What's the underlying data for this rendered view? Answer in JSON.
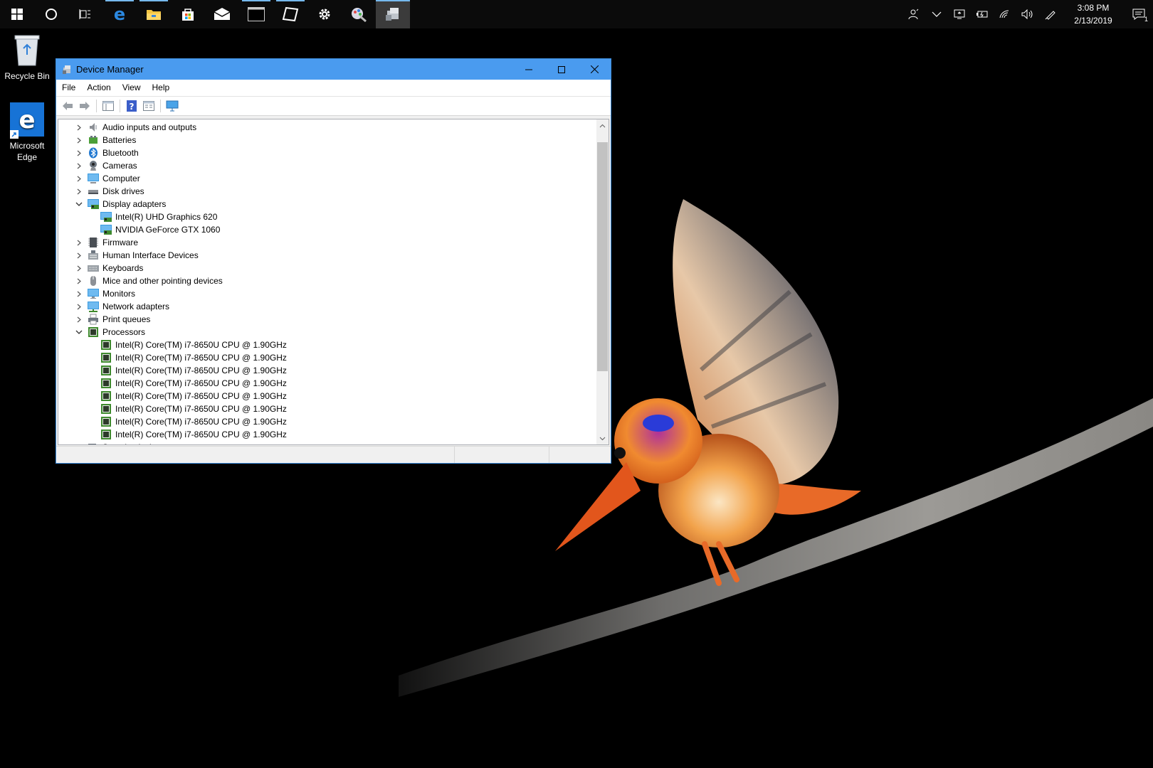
{
  "taskbar": {
    "pinned": [
      {
        "name": "start-button",
        "icon": "windows-logo-icon"
      },
      {
        "name": "cortana-button",
        "icon": "cortana-circle-icon"
      },
      {
        "name": "task-view-button",
        "icon": "task-view-icon"
      },
      {
        "name": "edge-button",
        "icon": "edge-icon"
      },
      {
        "name": "file-explorer-button",
        "icon": "folder-icon"
      },
      {
        "name": "store-button",
        "icon": "store-bag-icon"
      },
      {
        "name": "mail-button",
        "icon": "mail-icon"
      },
      {
        "name": "terminal-button",
        "icon": "terminal-icon"
      },
      {
        "name": "paint3d-button",
        "icon": "paint3d-icon"
      },
      {
        "name": "settings-button",
        "icon": "gear-icon"
      },
      {
        "name": "snip-button",
        "icon": "snip-icon"
      },
      {
        "name": "device-manager-button",
        "icon": "device-manager-icon"
      }
    ],
    "clock": {
      "time": "3:08 PM",
      "date": "2/13/2019"
    },
    "notification_count": "1"
  },
  "desktop": {
    "icons": [
      {
        "label": "Recycle Bin"
      },
      {
        "label": "Microsoft Edge"
      }
    ]
  },
  "window": {
    "title": "Device Manager",
    "menu": [
      "File",
      "Action",
      "View",
      "Help"
    ],
    "tree": [
      {
        "label": "Audio inputs and outputs",
        "level": 0,
        "state": "collapsed",
        "icon": "speaker-icon"
      },
      {
        "label": "Batteries",
        "level": 0,
        "state": "collapsed",
        "icon": "battery-icon"
      },
      {
        "label": "Bluetooth",
        "level": 0,
        "state": "collapsed",
        "icon": "bluetooth-icon"
      },
      {
        "label": "Cameras",
        "level": 0,
        "state": "collapsed",
        "icon": "camera-icon"
      },
      {
        "label": "Computer",
        "level": 0,
        "state": "collapsed",
        "icon": "computer-icon"
      },
      {
        "label": "Disk drives",
        "level": 0,
        "state": "collapsed",
        "icon": "disk-drive-icon"
      },
      {
        "label": "Display adapters",
        "level": 0,
        "state": "expanded",
        "icon": "display-adapter-icon"
      },
      {
        "label": "Intel(R) UHD Graphics 620",
        "level": 1,
        "state": "leaf",
        "icon": "display-adapter-icon"
      },
      {
        "label": "NVIDIA GeForce GTX 1060",
        "level": 1,
        "state": "leaf",
        "icon": "display-adapter-icon"
      },
      {
        "label": "Firmware",
        "level": 0,
        "state": "collapsed",
        "icon": "firmware-icon"
      },
      {
        "label": "Human Interface Devices",
        "level": 0,
        "state": "collapsed",
        "icon": "hid-icon"
      },
      {
        "label": "Keyboards",
        "level": 0,
        "state": "collapsed",
        "icon": "keyboard-icon"
      },
      {
        "label": "Mice and other pointing devices",
        "level": 0,
        "state": "collapsed",
        "icon": "mouse-icon"
      },
      {
        "label": "Monitors",
        "level": 0,
        "state": "collapsed",
        "icon": "monitor-icon"
      },
      {
        "label": "Network adapters",
        "level": 0,
        "state": "collapsed",
        "icon": "network-adapter-icon"
      },
      {
        "label": "Print queues",
        "level": 0,
        "state": "collapsed",
        "icon": "printer-icon"
      },
      {
        "label": "Processors",
        "level": 0,
        "state": "expanded",
        "icon": "processor-icon"
      },
      {
        "label": "Intel(R) Core(TM) i7-8650U CPU @ 1.90GHz",
        "level": 1,
        "state": "leaf",
        "icon": "processor-icon"
      },
      {
        "label": "Intel(R) Core(TM) i7-8650U CPU @ 1.90GHz",
        "level": 1,
        "state": "leaf",
        "icon": "processor-icon"
      },
      {
        "label": "Intel(R) Core(TM) i7-8650U CPU @ 1.90GHz",
        "level": 1,
        "state": "leaf",
        "icon": "processor-icon"
      },
      {
        "label": "Intel(R) Core(TM) i7-8650U CPU @ 1.90GHz",
        "level": 1,
        "state": "leaf",
        "icon": "processor-icon"
      },
      {
        "label": "Intel(R) Core(TM) i7-8650U CPU @ 1.90GHz",
        "level": 1,
        "state": "leaf",
        "icon": "processor-icon"
      },
      {
        "label": "Intel(R) Core(TM) i7-8650U CPU @ 1.90GHz",
        "level": 1,
        "state": "leaf",
        "icon": "processor-icon"
      },
      {
        "label": "Intel(R) Core(TM) i7-8650U CPU @ 1.90GHz",
        "level": 1,
        "state": "leaf",
        "icon": "processor-icon"
      },
      {
        "label": "Intel(R) Core(TM) i7-8650U CPU @ 1.90GHz",
        "level": 1,
        "state": "leaf",
        "icon": "processor-icon"
      },
      {
        "label": "Security devices",
        "level": 0,
        "state": "collapsed",
        "icon": "security-device-icon"
      }
    ]
  },
  "colors": {
    "titlebar": "#4a9bef",
    "taskbar": "#0b0b0b",
    "accent": "#76b9ed"
  }
}
